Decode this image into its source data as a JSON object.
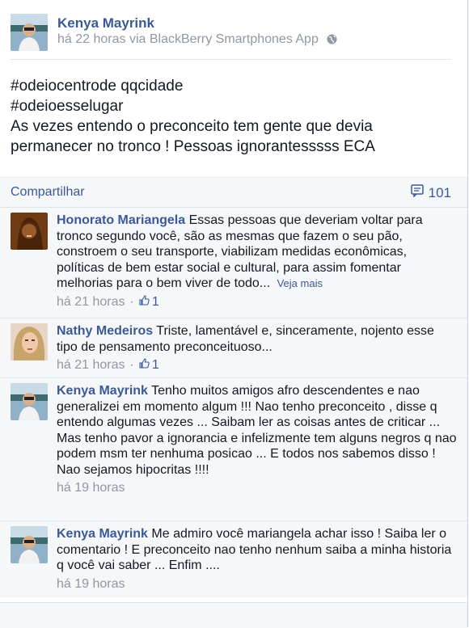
{
  "post": {
    "author": "Kenya Mayrink",
    "meta": "há 22 horas via BlackBerry Smartphones App",
    "privacy_icon": "globe-icon",
    "lines": [
      "#odeiocentrode qqcidade",
      "#odeioesselugar",
      "As vezes entendo o preconceito tem gente que devia",
      "permanecer no tronco ! Pessoas ignorantesssss ECA"
    ]
  },
  "actions": {
    "share": "Compartilhar",
    "comment_count": "101"
  },
  "comments": [
    {
      "author": "Honorato Mariangela",
      "text": "Essas pessoas que deveriam voltar para tronco segundo você, são as mesmas que fazem o seu pão, constroem o seu transporte, viabilizam medidas econômicas, políticas de bem estar social e cultural, para assim fomentar melhorias para o bem viver de todo...",
      "see_more": "Veja mais",
      "time": "há 21 horas",
      "likes": "1"
    },
    {
      "author": "Nathy Medeiros",
      "text": "Triste, lamentável e, sinceramente, nojento esse tipo de pensamento preconceituoso...",
      "time": "há 21 horas",
      "likes": "1"
    },
    {
      "author": "Kenya Mayrink",
      "text": "Tenho muitos amigos afro descendentes e nao generalizei em momento algum !!! Nao tenho preconceito , disse q entendo algumas vezes ... Saibam ler as coisas antes de criticar ...",
      "text2": "Mas tenho pavor a ignorancia e infelizmente tem alguns negros q nao podem msm ter nenhuma posicao ... E todos nos sabemos disso ! Nao sejamos hipocritas !!!!",
      "time": "há 19 horas"
    },
    {
      "author": "Kenya Mayrink",
      "text": "Me admiro você mariangela achar isso ! Saiba ler o comentario ! E preconceito nao tenho nenhum saiba a minha historia q você vai saber ... Enfim ....",
      "time": "há 19 horas"
    }
  ],
  "colors": {
    "link": "#3b5998",
    "meta": "#9197a3",
    "comment_bg": "#f6f7f9"
  }
}
